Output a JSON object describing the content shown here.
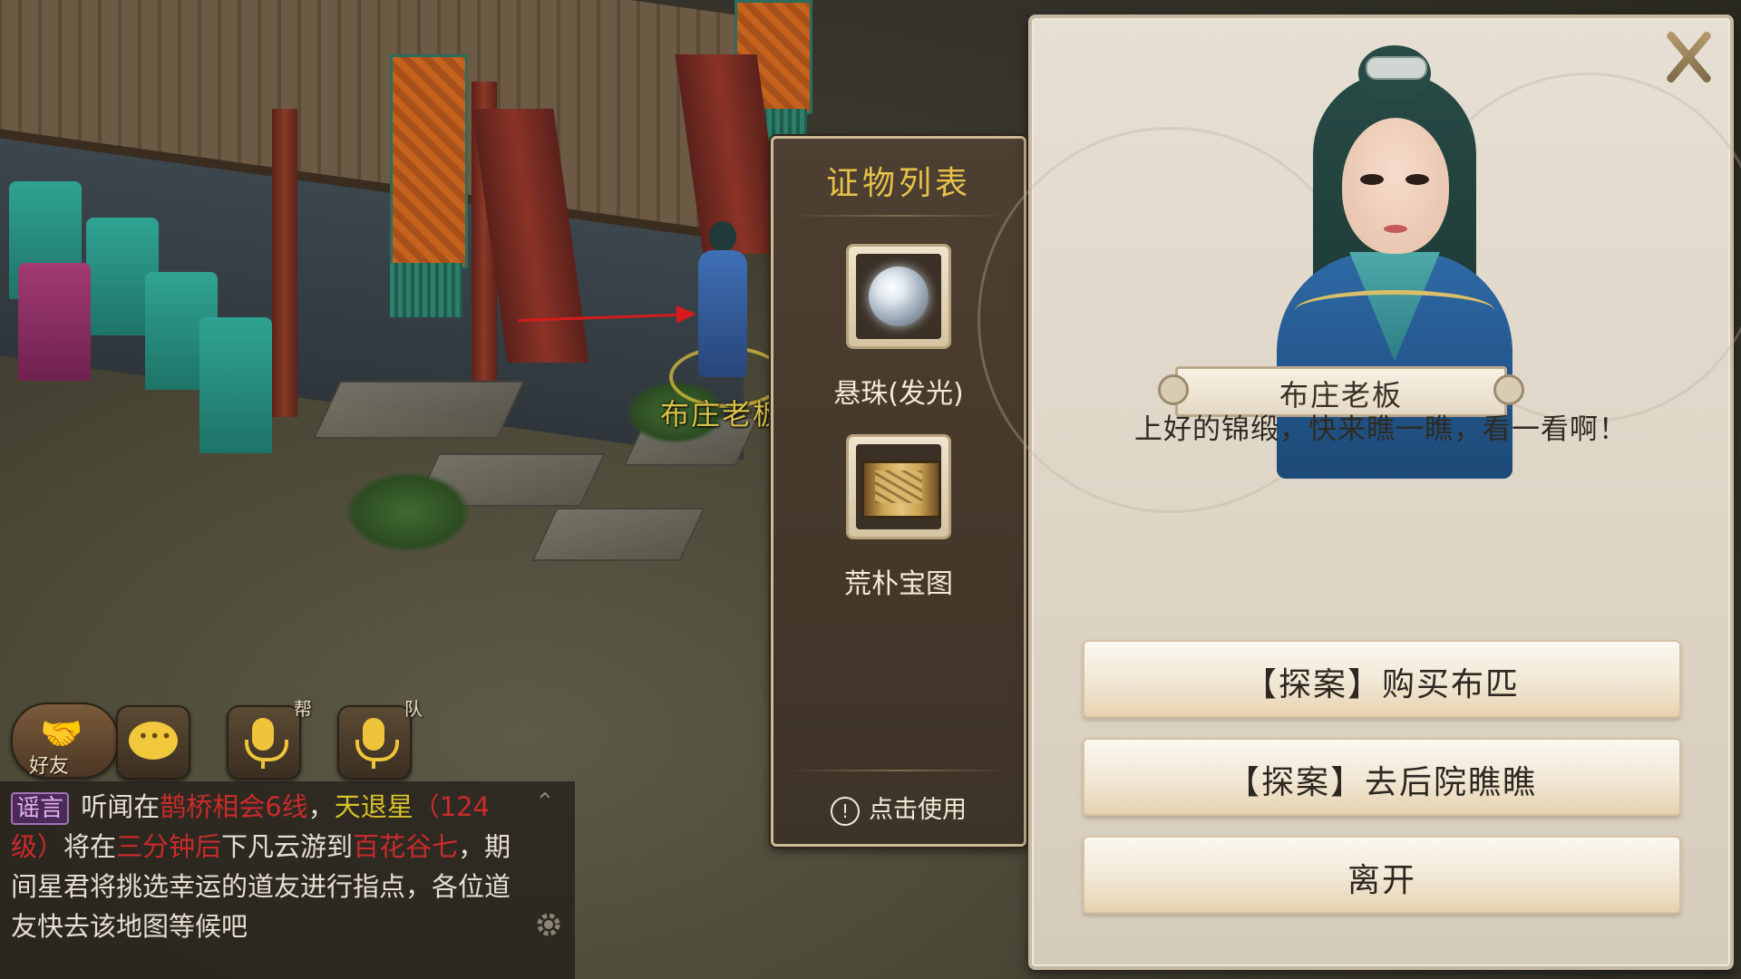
{
  "scene": {
    "npc_name": "布庄老板"
  },
  "hud": {
    "friend_label": "好友",
    "guild_voice_tag": "帮",
    "team_voice_tag": "队"
  },
  "chat": {
    "tag": "谣言",
    "segments": [
      {
        "text": "听闻在",
        "color": "normal"
      },
      {
        "text": "鹊桥相会6线",
        "color": "red"
      },
      {
        "text": "，",
        "color": "normal"
      },
      {
        "text": "天退星",
        "color": "yellow"
      },
      {
        "text": "（124级）",
        "color": "red"
      },
      {
        "text": "将在",
        "color": "normal"
      },
      {
        "text": "三分钟后",
        "color": "red"
      },
      {
        "text": "下凡云游到",
        "color": "normal"
      },
      {
        "text": "百花谷七",
        "color": "red"
      },
      {
        "text": "，期间星君将挑选幸运的道友进行指点，各位道友快去该地图等候吧",
        "color": "normal"
      }
    ]
  },
  "evidence": {
    "title": "证物列表",
    "items": [
      {
        "label": "悬珠(发光)",
        "icon": "pearl-icon"
      },
      {
        "label": "荒朴宝图",
        "icon": "treasure-map-icon"
      }
    ],
    "use_label": "点击使用"
  },
  "dialog": {
    "npc_title": "布庄老板",
    "line": "上好的锦缎，快来瞧一瞧，看一看啊！",
    "options": [
      {
        "label": "【探案】购买布匹"
      },
      {
        "label": "【探案】去后院瞧瞧"
      },
      {
        "label": "离开"
      }
    ]
  },
  "colors": {
    "accent_gold": "#e7c24a",
    "chat_red": "#c92b2b",
    "chat_yellow": "#d8c02a",
    "arrow_red": "#d51b1b"
  }
}
